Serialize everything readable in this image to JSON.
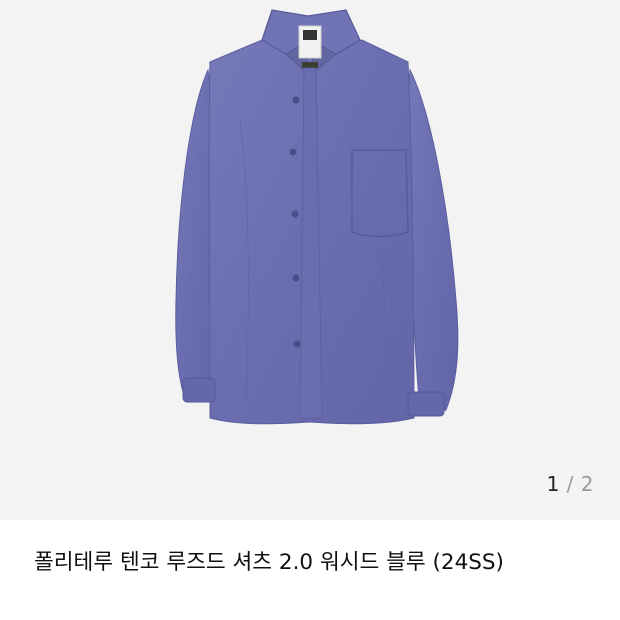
{
  "gallery": {
    "image_alt": "폴리테루 텐코 루즈드 셔츠 2.0 워시드 블루",
    "indicator": {
      "current": "1",
      "separator": "/",
      "total": "2"
    }
  },
  "product": {
    "title": "폴리테루 텐코 루즈드 셔츠 2.0 워시드 블루 (24SS)"
  },
  "colors": {
    "background": "#f3f3f3",
    "shirt": "#6f73b4",
    "shirt_shadow": "#5b5fa0"
  }
}
